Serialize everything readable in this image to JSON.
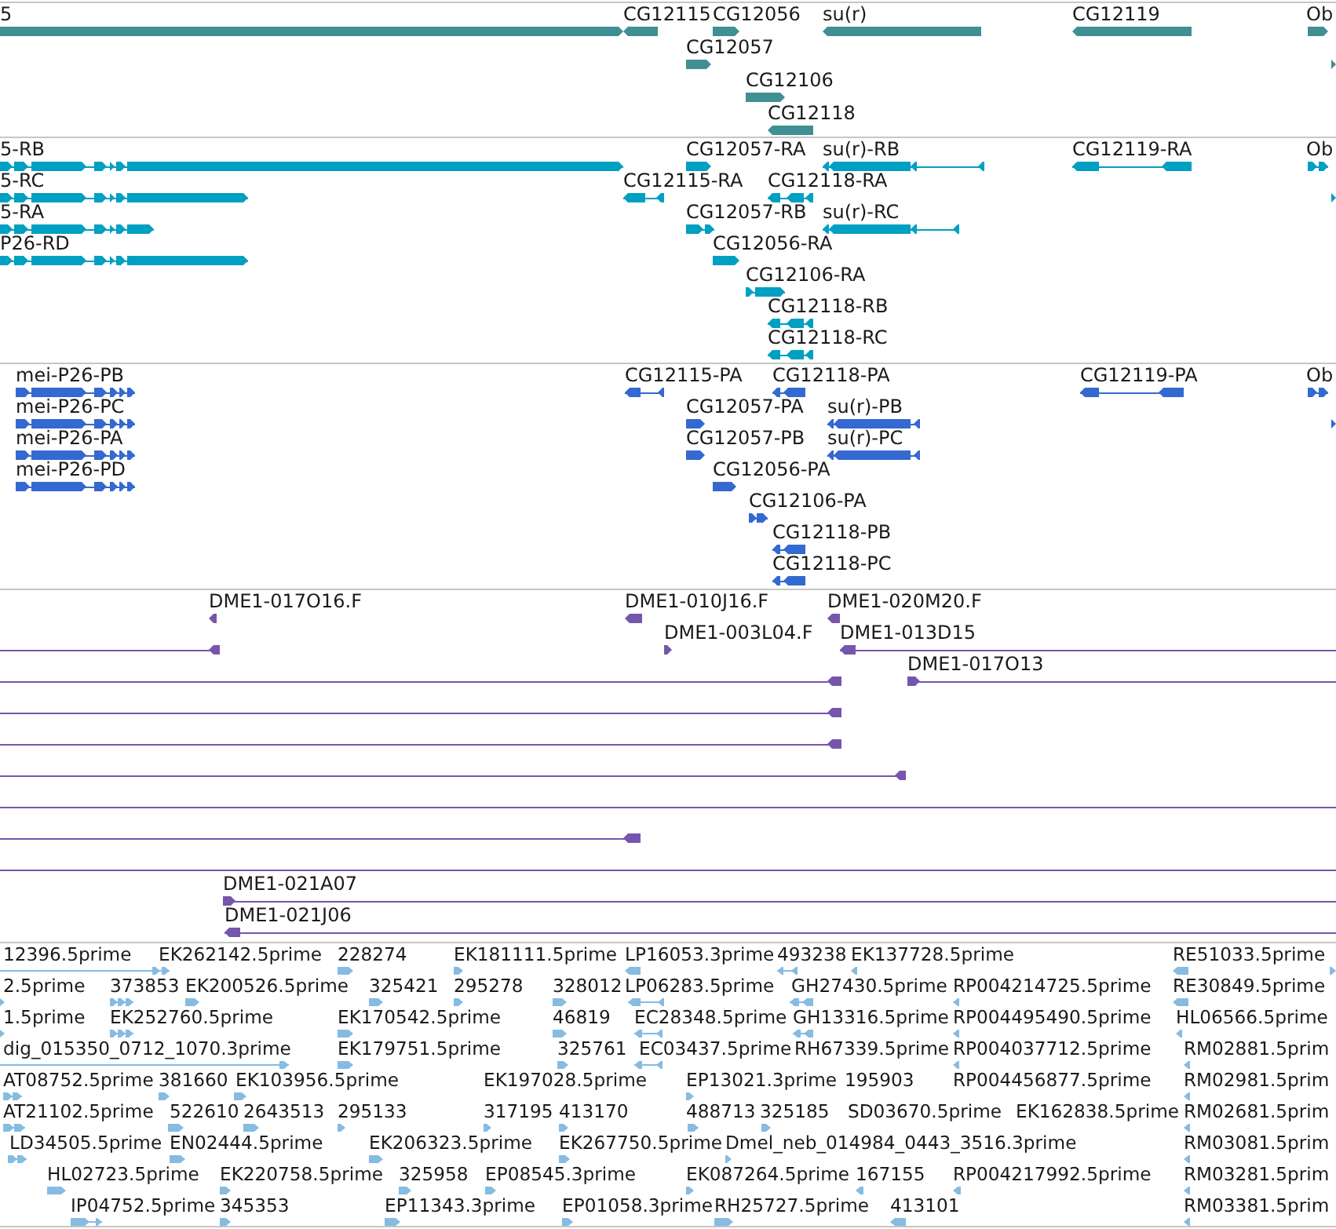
{
  "tracks": [
    {
      "kind": "gene",
      "features": [
        {
          "label": "5",
          "reverse": false
        },
        {
          "label": "CG12115",
          "reverse": true
        },
        {
          "label": "CG12056",
          "reverse": false
        },
        {
          "label": "su(r)",
          "reverse": true
        },
        {
          "label": "CG12119",
          "reverse": true
        },
        {
          "label": "Ob",
          "reverse": false
        },
        {
          "label": "CG12057",
          "reverse": false
        },
        {
          "reverse": false
        },
        {
          "label": "CG12106",
          "reverse": false
        },
        {
          "label": "CG12118",
          "reverse": true
        }
      ]
    },
    {
      "kind": "transcript",
      "features": [
        {
          "label": "5-RB",
          "reverse": false
        },
        {
          "label": "CG12057-RA",
          "reverse": false
        },
        {
          "label": "su(r)-RB",
          "reverse": true
        },
        {
          "label": "CG12119-RA",
          "reverse": true
        },
        {
          "label": "Ob",
          "reverse": false
        },
        {
          "label": "5-RC",
          "reverse": false
        },
        {
          "label": "CG12115-RA",
          "reverse": true
        },
        {
          "label": "CG12118-RA",
          "reverse": true
        },
        {
          "reverse": false
        },
        {
          "label": "5-RA",
          "reverse": false
        },
        {
          "label": "CG12057-RB",
          "reverse": false
        },
        {
          "label": "su(r)-RC",
          "reverse": true
        },
        {
          "label": "P26-RD",
          "reverse": false
        },
        {
          "label": "CG12056-RA",
          "reverse": false
        },
        {
          "label": "CG12106-RA",
          "reverse": false
        },
        {
          "label": "CG12118-RB",
          "reverse": true
        },
        {
          "label": "CG12118-RC",
          "reverse": true
        }
      ]
    },
    {
      "kind": "polypeptide",
      "features": [
        {
          "label": "mei-P26-PB",
          "reverse": false
        },
        {
          "label": "CG12115-PA",
          "reverse": true
        },
        {
          "label": "CG12118-PA",
          "reverse": true
        },
        {
          "label": "CG12119-PA",
          "reverse": true
        },
        {
          "label": "Ob",
          "reverse": false
        },
        {
          "label": "mei-P26-PC",
          "reverse": false
        },
        {
          "label": "CG12057-PA",
          "reverse": false
        },
        {
          "label": "su(r)-PB",
          "reverse": true
        },
        {
          "reverse": false
        },
        {
          "label": "mei-P26-PA",
          "reverse": false
        },
        {
          "label": "CG12057-PB",
          "reverse": false
        },
        {
          "label": "su(r)-PC",
          "reverse": true
        },
        {
          "label": "mei-P26-PD",
          "reverse": false
        },
        {
          "label": "CG12056-PA",
          "reverse": false
        },
        {
          "label": "CG12106-PA",
          "reverse": false
        },
        {
          "label": "CG12118-PB",
          "reverse": true
        },
        {
          "label": "CG12118-PC",
          "reverse": true
        }
      ]
    },
    {
      "kind": "clone",
      "features": [
        {
          "kind": "arrow",
          "label": "DME1-017O16.F",
          "reverse": true
        },
        {
          "kind": "arrow",
          "label": "DME1-010J16.F",
          "reverse": true
        },
        {
          "kind": "arrow",
          "label": "DME1-020M20.F",
          "reverse": true
        },
        {
          "kind": "arrow",
          "reverse": true
        },
        {
          "kind": "arrow",
          "label": "DME1-003L04.F",
          "reverse": false
        },
        {
          "kind": "arrow",
          "label": "DME1-013D15",
          "reverse": true
        },
        {
          "kind": "arrow",
          "reverse": true
        },
        {
          "kind": "arrow",
          "label": "DME1-017O13",
          "reverse": false
        },
        {
          "kind": "arrow",
          "reverse": true
        },
        {
          "kind": "arrow",
          "reverse": true
        },
        {
          "kind": "arrow",
          "reverse": true
        },
        {
          "kind": "line"
        },
        {
          "kind": "arrow",
          "reverse": true
        },
        {
          "kind": "line"
        },
        {
          "kind": "arrow",
          "label": "DME1-021A07",
          "reverse": false
        },
        {
          "kind": "arrow",
          "label": "DME1-021J06",
          "reverse": true
        }
      ]
    },
    {
      "kind": "est",
      "features": [
        {
          "label": "12396.5prime",
          "reverse": false
        },
        {
          "label": "EK262142.5prime"
        },
        {
          "label": "228274",
          "reverse": false
        },
        {
          "label": "EK181111.5prime",
          "reverse": false
        },
        {
          "label": "LP16053.3prime",
          "reverse": true
        },
        {
          "label": "493238",
          "reverse": true
        },
        {
          "label": "EK137728.5prime",
          "reverse": true
        },
        {
          "label": "RE51033.5prime",
          "reverse": true
        },
        {
          "reverse": false
        },
        {
          "label": "2.5prime",
          "reverse": false
        },
        {
          "label": "373853",
          "reverse": false
        },
        {
          "label": "EK200526.5prime",
          "reverse": false
        },
        {
          "label": "325421",
          "reverse": false
        },
        {
          "label": "295278",
          "reverse": false
        },
        {
          "label": "328012",
          "reverse": false
        },
        {
          "label": "LP06283.5prime",
          "reverse": true
        },
        {
          "label": "GH27430.5prime",
          "reverse": true
        },
        {
          "label": "RP004214725.5prime",
          "reverse": true
        },
        {
          "label": "RE30849.5prime",
          "reverse": true
        },
        {
          "label": "1.5prime",
          "reverse": false
        },
        {
          "label": "EK252760.5prime",
          "reverse": false
        },
        {
          "label": "EK170542.5prime",
          "reverse": false
        },
        {
          "label": "46819",
          "reverse": false
        },
        {
          "label": "EC28348.5prime",
          "reverse": true
        },
        {
          "label": "GH13316.5prime",
          "reverse": true
        },
        {
          "label": "RP004495490.5prime",
          "reverse": true
        },
        {
          "label": "HL06566.5prime",
          "reverse": true
        },
        {
          "label": "dig_015350_0712_1070.3prime",
          "reverse": false
        },
        {
          "label": "EK179751.5prime",
          "reverse": false
        },
        {
          "label": "325761",
          "reverse": false
        },
        {
          "label": "EC03437.5prime",
          "reverse": true
        },
        {
          "label": "RH67339.5prime"
        },
        {
          "label": "RP004037712.5prime",
          "reverse": true
        },
        {
          "label": "RM02881.5prim",
          "reverse": true
        },
        {
          "label": "AT08752.5prime",
          "reverse": false
        },
        {
          "label": "381660",
          "reverse": false
        },
        {
          "label": "EK103956.5prime",
          "reverse": false
        },
        {
          "label": "EK197028.5prime"
        },
        {
          "label": "EP13021.3prime",
          "reverse": false
        },
        {
          "label": "195903"
        },
        {
          "label": "RP004456877.5prime"
        },
        {
          "label": "RM02981.5prim",
          "reverse": true
        },
        {
          "label": "AT21102.5prime",
          "reverse": false
        },
        {
          "label": "522610",
          "reverse": false
        },
        {
          "label": "2643513",
          "reverse": false
        },
        {
          "label": "295133",
          "reverse": false
        },
        {
          "label": "317195",
          "reverse": false
        },
        {
          "label": "413170",
          "reverse": false
        },
        {
          "label": "488713",
          "reverse": false
        },
        {
          "label": "325185",
          "reverse": false
        },
        {
          "label": "SD03670.5prime"
        },
        {
          "label": "EK162838.5prime"
        },
        {
          "label": "RM02681.5prim",
          "reverse": true
        },
        {
          "label": "LD34505.5prime",
          "reverse": false
        },
        {
          "label": "EN02444.5prime",
          "reverse": false
        },
        {
          "label": "EK206323.5prime",
          "reverse": false
        },
        {
          "label": "EK267750.5prime",
          "reverse": false
        },
        {
          "label": "Dmel_neb_014984_0443_3516.3prime",
          "reverse": false
        },
        {
          "label": "RM03081.5prim",
          "reverse": true
        },
        {
          "label": "HL02723.5prime",
          "reverse": false
        },
        {
          "label": "EK220758.5prime",
          "reverse": false
        },
        {
          "label": "325958",
          "reverse": false
        },
        {
          "label": "EP08545.3prime",
          "reverse": false
        },
        {
          "label": "EK087264.5prime",
          "reverse": false
        },
        {
          "label": "167155",
          "reverse": true
        },
        {
          "label": "RP004217992.5prime",
          "reverse": true
        },
        {
          "label": "RM03281.5prim",
          "reverse": true
        },
        {
          "label": "IP04752.5prime",
          "reverse": false
        },
        {
          "label": "345353",
          "reverse": false
        },
        {
          "label": "EP11343.3prime",
          "reverse": false
        },
        {
          "label": "EP01058.3prime",
          "reverse": false
        },
        {
          "label": "RH25727.5prime",
          "reverse": false
        },
        {
          "label": "413101",
          "reverse": true
        },
        {
          "label": "RM03381.5prim",
          "reverse": true
        }
      ]
    }
  ]
}
